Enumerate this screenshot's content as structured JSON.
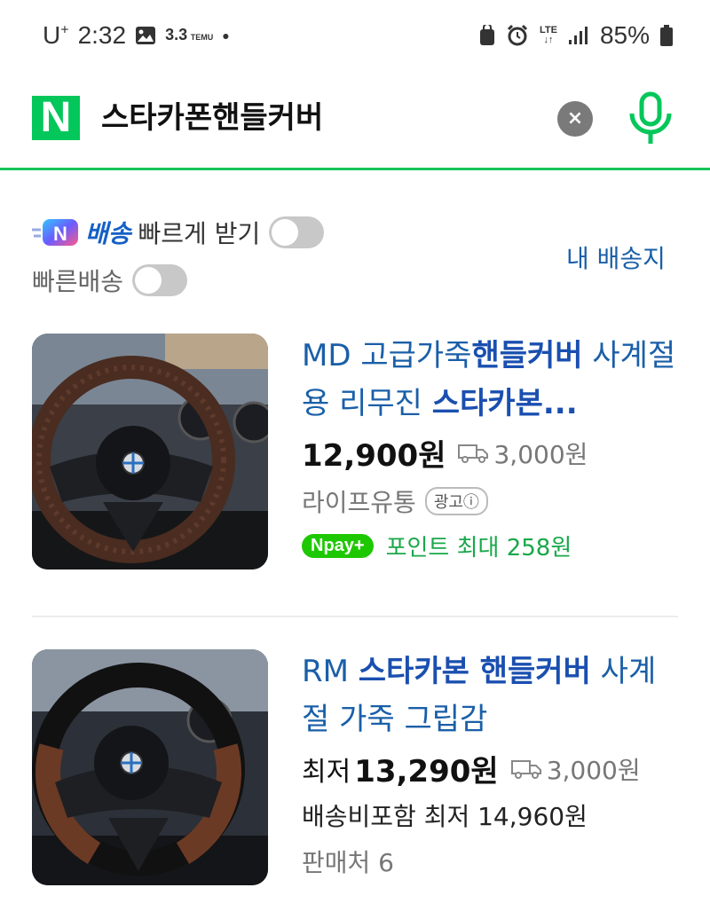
{
  "status_bar": {
    "carrier": "U",
    "time": "2:32",
    "temu_text": "3.3",
    "temu_brand": "TEMU",
    "network": "LTE",
    "battery": "85%"
  },
  "search": {
    "logo": "N",
    "query": "스타카폰핸들커버",
    "clear_icon": "×",
    "mic_icon": "microphone-icon"
  },
  "filters": {
    "badge_letter": "N",
    "delivery_label": "배송",
    "fast_receive_label": "빠르게 받기",
    "fast_delivery_label": "빠른배송",
    "my_address_link": "내 배송지"
  },
  "products": [
    {
      "title_prefix": "MD 고급가죽",
      "title_bold1": "핸들커버",
      "title_mid": " 사계절용 리무진 ",
      "title_bold2": "스타카본...",
      "price": "12,900원",
      "shipping_fee": "3,000원",
      "seller": "라이프유통",
      "ad_label": "광고ⓘ",
      "npay_label": "Npay+",
      "points": "포인트 최대 258원"
    },
    {
      "title_prefix": "RM ",
      "title_bold1": "스타카본 핸들커버",
      "title_mid": " 사계절 가죽 그립감",
      "price_prefix": "최저",
      "price": "13,290원",
      "shipping_fee": "3,000원",
      "including_shipping": "배송비포함 최저 14,960원",
      "sellers": "판매처 6"
    }
  ],
  "colors": {
    "naver_green": "#03c75a",
    "link_blue": "#1a5fa8",
    "points_green": "#19a84a"
  }
}
